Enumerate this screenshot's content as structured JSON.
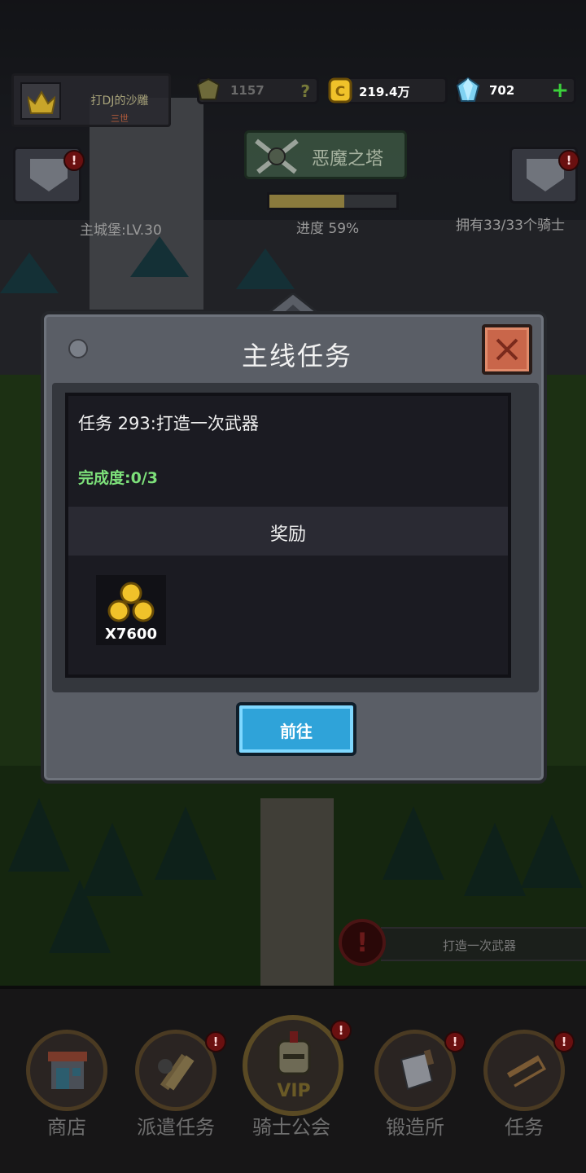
{
  "player": {
    "name": "打DJ的沙雕",
    "subtitle": "三世"
  },
  "resources": {
    "power": "1157",
    "power_help": "?",
    "gold": "219.4万",
    "gems": "702",
    "gems_add": "+"
  },
  "tower": {
    "label": "恶魔之塔",
    "progress_text": "进度 59%",
    "progress": 0.59
  },
  "castle": {
    "level_text": "主城堡:LV.30"
  },
  "knights": {
    "text": "拥有33/33个骑士"
  },
  "alert_symbol": "!",
  "modal": {
    "title": "主线任务",
    "task_title": "任务 293:打造一次武器",
    "task_progress": "完成度:0/3",
    "reward_header": "奖励",
    "reward_count": "X7600",
    "reward_icon": "gold-coins-icon",
    "go_button": "前往"
  },
  "quest_hint": {
    "text": "打造一次武器",
    "icon": "!"
  },
  "nav": {
    "items": [
      {
        "label": "商店",
        "icon": "shop-icon",
        "alert": false
      },
      {
        "label": "派遣任务",
        "icon": "dispatch-icon",
        "alert": true
      },
      {
        "label": "骑士公会",
        "icon": "vip-knight-icon",
        "alert": true
      },
      {
        "label": "锻造所",
        "icon": "forge-icon",
        "alert": true
      },
      {
        "label": "任务",
        "icon": "quest-scroll-icon",
        "alert": true
      }
    ],
    "vip_badge": "VIP"
  },
  "colors": {
    "accent_blue": "#2fa3d9",
    "close_red": "#c9664a",
    "progress_green": "#7de07a",
    "gem_plus_green": "#3bd13b"
  }
}
